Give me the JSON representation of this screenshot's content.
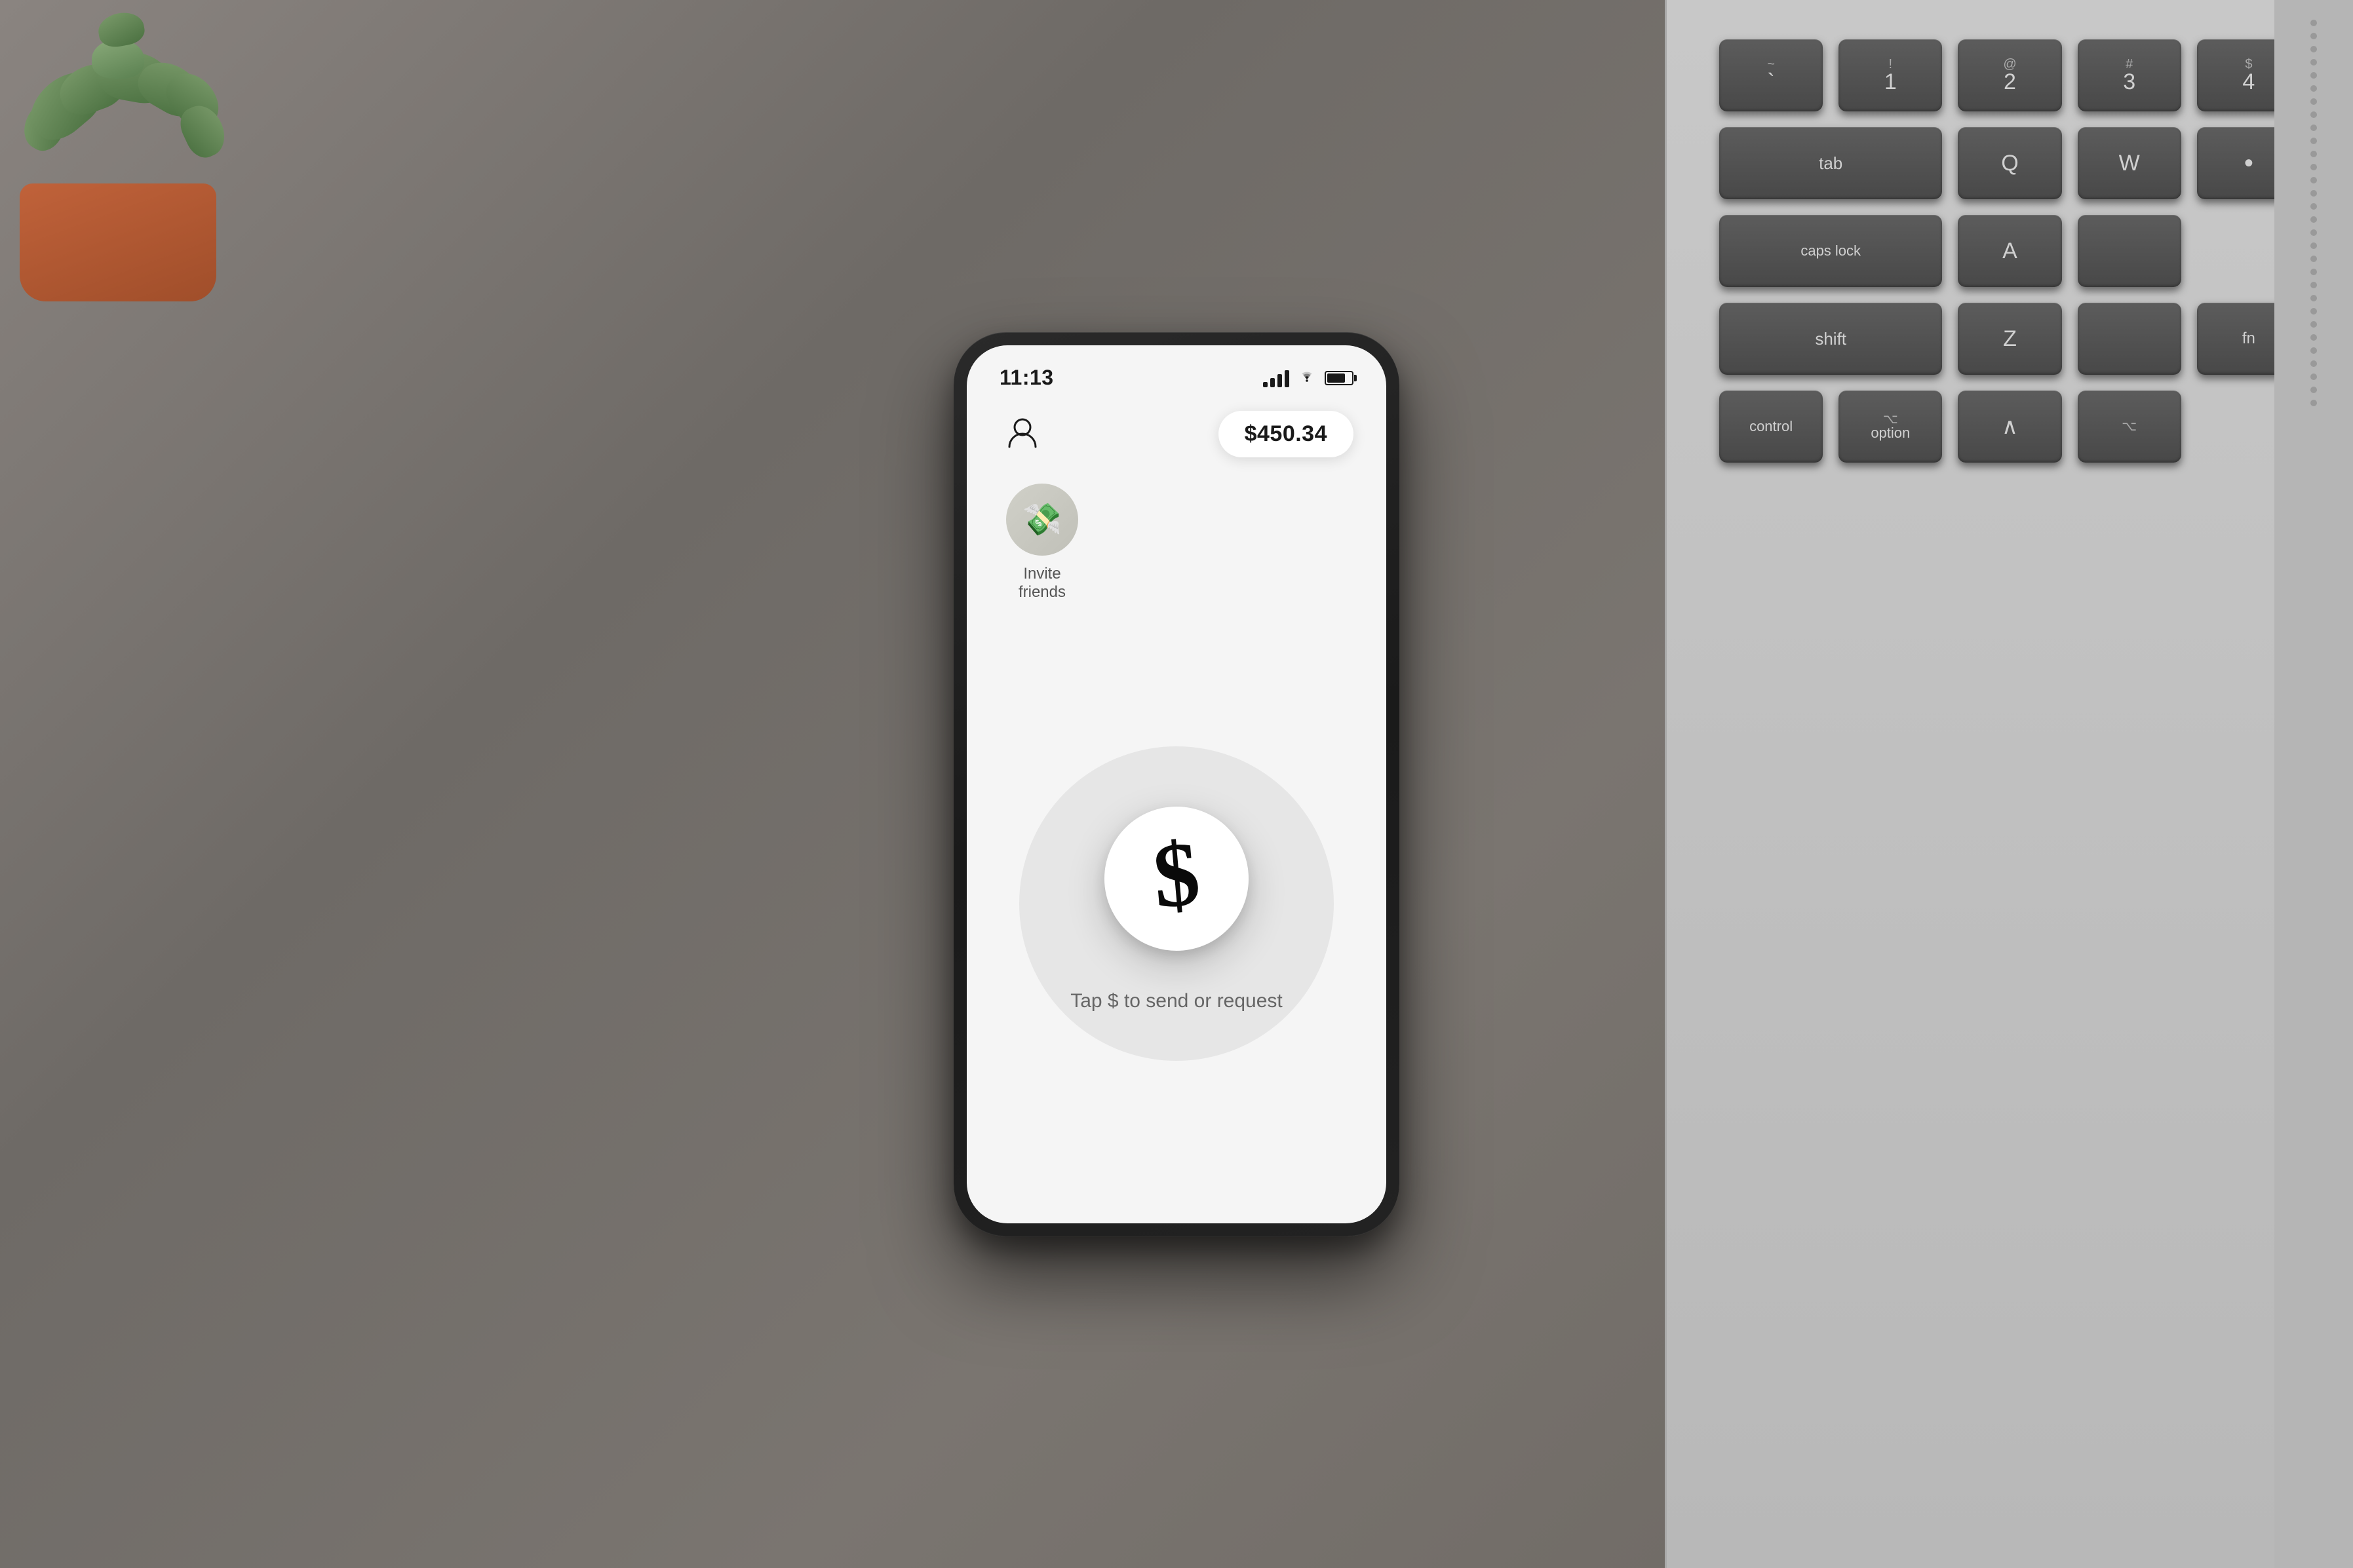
{
  "scene": {
    "background_color": "#7a7570"
  },
  "phone": {
    "status_bar": {
      "time": "11:13",
      "signal": "●●●",
      "wifi": "wifi",
      "battery": "75%"
    },
    "header": {
      "profile_icon_label": "profile",
      "balance": "$450.34"
    },
    "invite_section": {
      "avatar_emoji": "💸",
      "label": "Invite friends"
    },
    "main_action": {
      "dollar_symbol": "$",
      "instruction": "Tap $ to send or request"
    }
  },
  "keyboard": {
    "rows": [
      [
        {
          "top": "~",
          "main": "`"
        },
        {
          "top": "!",
          "main": "1"
        },
        {
          "top": "@",
          "main": "2"
        },
        {
          "top": "#",
          "main": "3"
        },
        {
          "top": "$",
          "main": "4"
        }
      ],
      [
        {
          "top": "",
          "main": "tab",
          "wide": true
        },
        {
          "top": "",
          "main": "Q"
        },
        {
          "top": "",
          "main": "W"
        }
      ],
      [
        {
          "top": "•",
          "main": ""
        },
        {
          "top": "",
          "main": "caps lock",
          "wide": true
        },
        {
          "top": "",
          "main": "A"
        }
      ],
      [
        {
          "top": "",
          "main": "shift",
          "wide": true
        },
        {
          "top": "",
          "main": "Z"
        }
      ],
      [
        {
          "top": "",
          "main": "fn"
        },
        {
          "top": "",
          "main": "control"
        },
        {
          "top": "",
          "main": "option"
        }
      ]
    ]
  }
}
